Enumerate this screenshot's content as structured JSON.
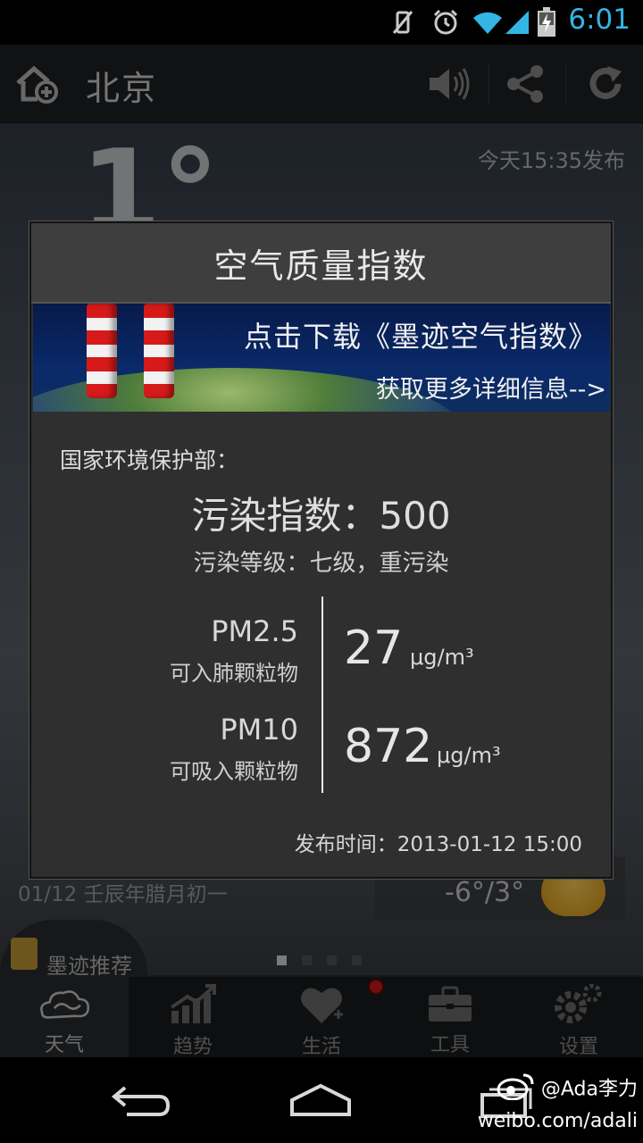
{
  "status_bar": {
    "time": "6:01"
  },
  "app": {
    "city": "北京",
    "publish_time": "今天15:35发布",
    "current_temp": "1°",
    "date_line": "01/12 壬辰年腊月初一",
    "temp_range": "-6°/3°",
    "promo_label": "墨迹推荐"
  },
  "dialog": {
    "title": "空气质量指数",
    "banner": {
      "line1": "点击下载《墨迹空气指数》",
      "line2": "获取更多详细信息-->"
    },
    "source": "国家环境保护部：",
    "pollution_index": "污染指数：500",
    "pollution_level": "污染等级：七级，重污染",
    "pm25": {
      "name": "PM2.5",
      "sub": "可入肺颗粒物",
      "value": "27",
      "unit": "μg/m³"
    },
    "pm10": {
      "name": "PM10",
      "sub": "可吸入颗粒物",
      "value": "872",
      "unit": "μg/m³"
    },
    "release_time": "发布时间：2013-01-12 15:00"
  },
  "tabs": [
    {
      "label": "天气",
      "icon": "weather-cloud-icon",
      "active": true
    },
    {
      "label": "趋势",
      "icon": "trend-chart-icon",
      "active": false
    },
    {
      "label": "生活",
      "icon": "heart-icon",
      "active": false
    },
    {
      "label": "工具",
      "icon": "toolbox-icon",
      "active": false
    },
    {
      "label": "设置",
      "icon": "gear-icon",
      "active": false
    }
  ],
  "watermark": {
    "user": "@Ada李力",
    "url": "weibo.com/adali"
  }
}
